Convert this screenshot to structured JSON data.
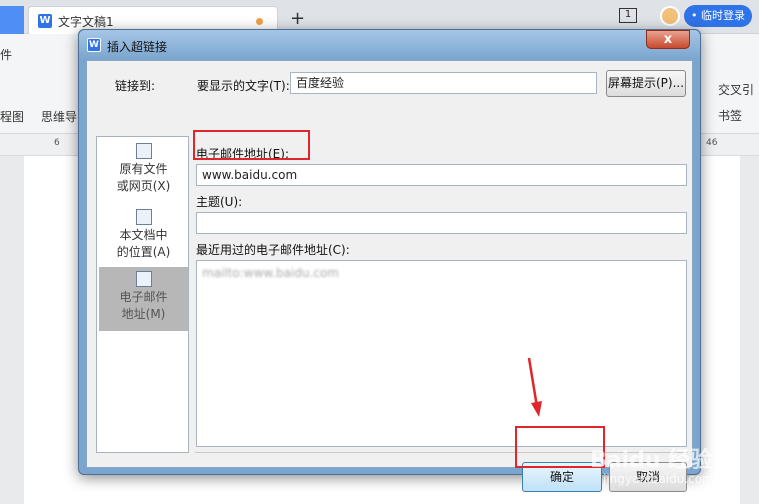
{
  "app": {
    "doc_tab_title": "文字文稿1",
    "new_tab": "+",
    "window_count": "1",
    "login_button": "• 临时登录",
    "toolbar_left_partial": "件",
    "toolbar_item_partial_1": "程图",
    "toolbar_item_partial_2": "思维导",
    "toolbar_right_1": "交叉引",
    "toolbar_right_2": "书签",
    "ruler_left": "6",
    "ruler_right": "46"
  },
  "dialog": {
    "title": "插入超链接",
    "close_glyph": "x",
    "link_to_label": "链接到:",
    "display_text_label": "要显示的文字(T):",
    "display_text_value": "百度经验",
    "screentip_button": "屏幕提示(P)...",
    "link_types": [
      {
        "label_line1": "原有文件",
        "label_line2": "或网页(X)",
        "icon": "web-page-icon",
        "selected": false
      },
      {
        "label_line1": "本文档中",
        "label_line2": "的位置(A)",
        "icon": "document-place-icon",
        "selected": false
      },
      {
        "label_line1": "电子邮件",
        "label_line2": "地址(M)",
        "icon": "email-icon",
        "selected": true
      }
    ],
    "email_label": "电子邮件地址(E):",
    "email_value": "www.baidu.com",
    "subject_label": "主题(U):",
    "subject_value": "",
    "recent_label": "最近用过的电子邮件地址(C):",
    "recent_items": [
      "mailto:www.baidu.com"
    ],
    "ok_button": "确定",
    "cancel_button": "取消"
  },
  "watermark": {
    "brand": "Baidu 经验",
    "url": "jingyan.baidu.com"
  },
  "colors": {
    "accent": "#2f73e8",
    "annotation": "#e0252b"
  }
}
